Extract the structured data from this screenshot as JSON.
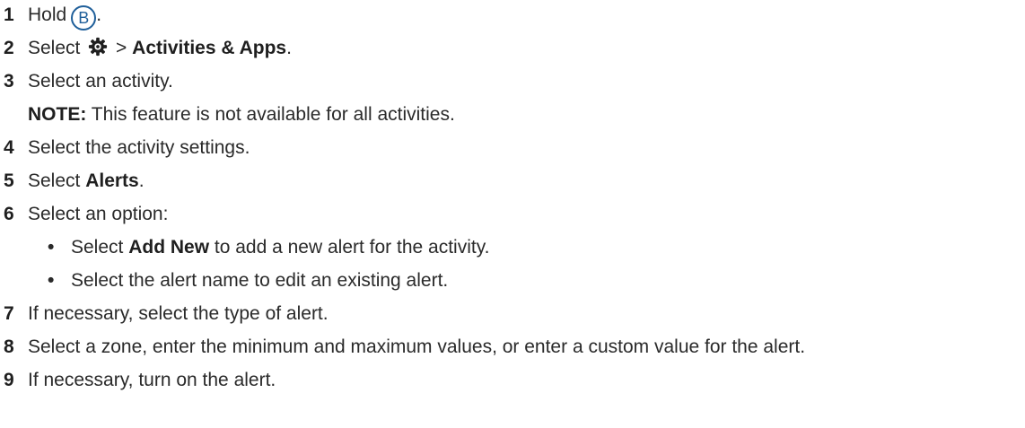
{
  "steps": [
    {
      "num": "1",
      "pre": "Hold",
      "button": "B",
      "post": "."
    },
    {
      "num": "2",
      "pre": "Select",
      "icon": "gear-icon",
      "sep": " > ",
      "bold": "Activities & Apps",
      "post": "."
    },
    {
      "num": "3",
      "text": "Select an activity."
    },
    {
      "note_label": "NOTE:",
      "note_text": " This feature is not available for all activities."
    },
    {
      "num": "4",
      "text": "Select the activity settings."
    },
    {
      "num": "5",
      "pre": "Select ",
      "bold": "Alerts",
      "post": "."
    },
    {
      "num": "6",
      "text": "Select an option:"
    },
    {
      "bullet": "•",
      "pre": "Select ",
      "bold": "Add New",
      "post": " to add a new alert for the activity."
    },
    {
      "bullet": "•",
      "text": "Select the alert name to edit an existing alert."
    },
    {
      "num": "7",
      "text": "If necessary, select the type of alert."
    },
    {
      "num": "8",
      "text": "Select a zone, enter the minimum and maximum values, or enter a custom value for the alert."
    },
    {
      "num": "9",
      "text": "If necessary, turn on the alert."
    }
  ],
  "colors": {
    "text": "#2a2a2a",
    "button_accent": "#1f5f9a"
  }
}
